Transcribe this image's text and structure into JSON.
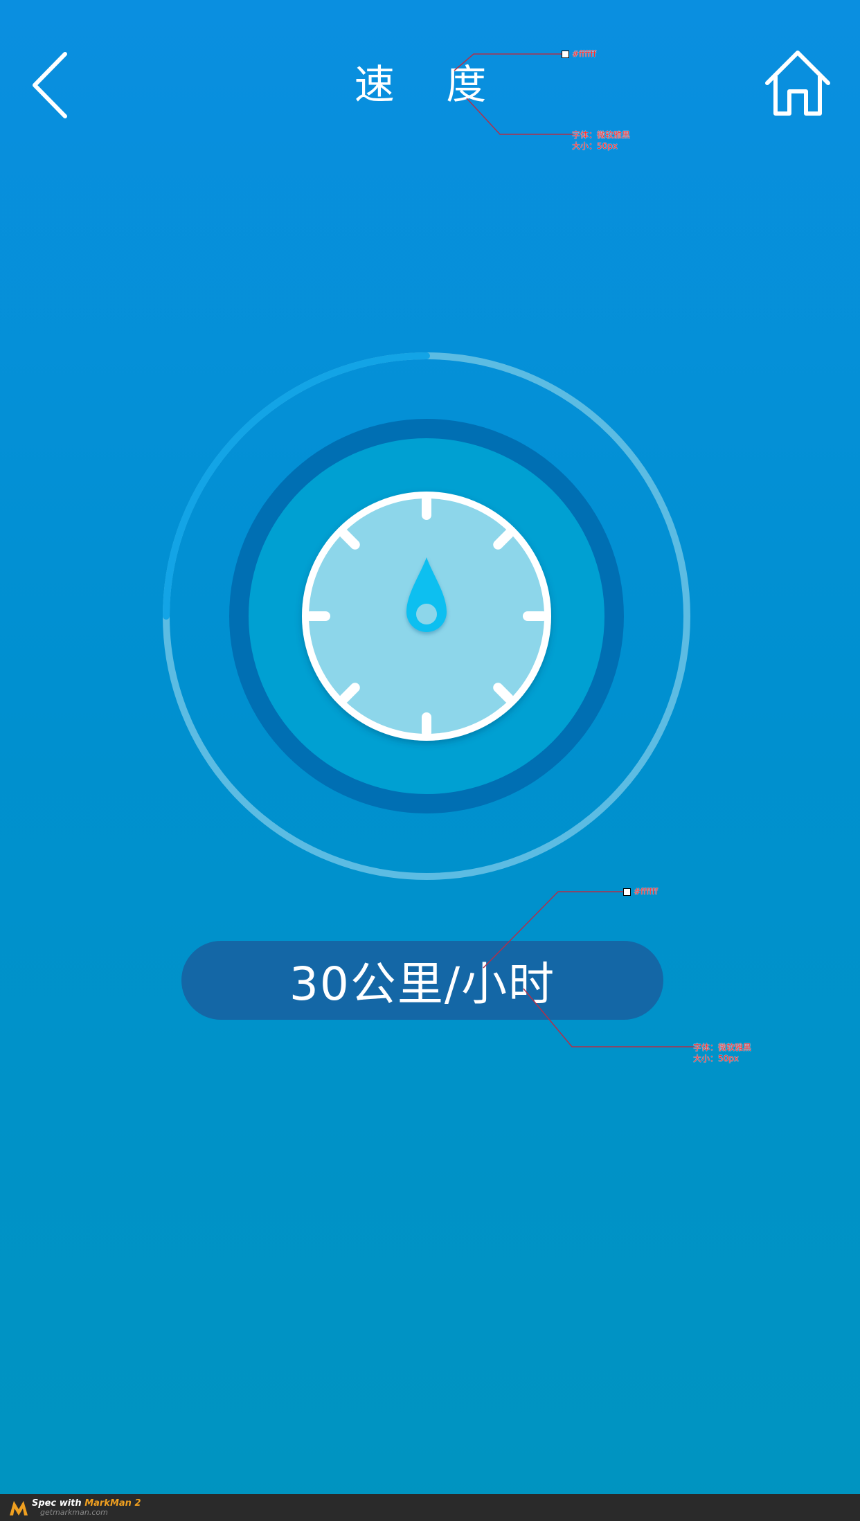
{
  "header": {
    "title": "速 度",
    "back_icon": "chevron-left-icon",
    "home_icon": "home-icon"
  },
  "gauge": {
    "icon": "compass-icon",
    "progress_fraction": 0.75,
    "colors": {
      "outer_ring_track": "#5cbce3",
      "outer_ring_progress": "#13a4e6",
      "mid_ring": "#006fb3",
      "inner_disc": "#00a0d2",
      "dial_border": "#ffffff",
      "dial_face": "#8dd6ea",
      "needle": "#11bff0"
    }
  },
  "speed": {
    "value": "30公里/小时"
  },
  "annotations": {
    "title_color": "#ffffff",
    "title_font": "字体：微软雅黑",
    "title_size": "大小：50px",
    "speed_color": "#ffffff",
    "speed_font": "字体：微软雅黑",
    "speed_size": "大小：50px"
  },
  "footer": {
    "spec_with": "Spec with ",
    "brand": "MarkMan 2",
    "url": "getmarkman.com"
  }
}
